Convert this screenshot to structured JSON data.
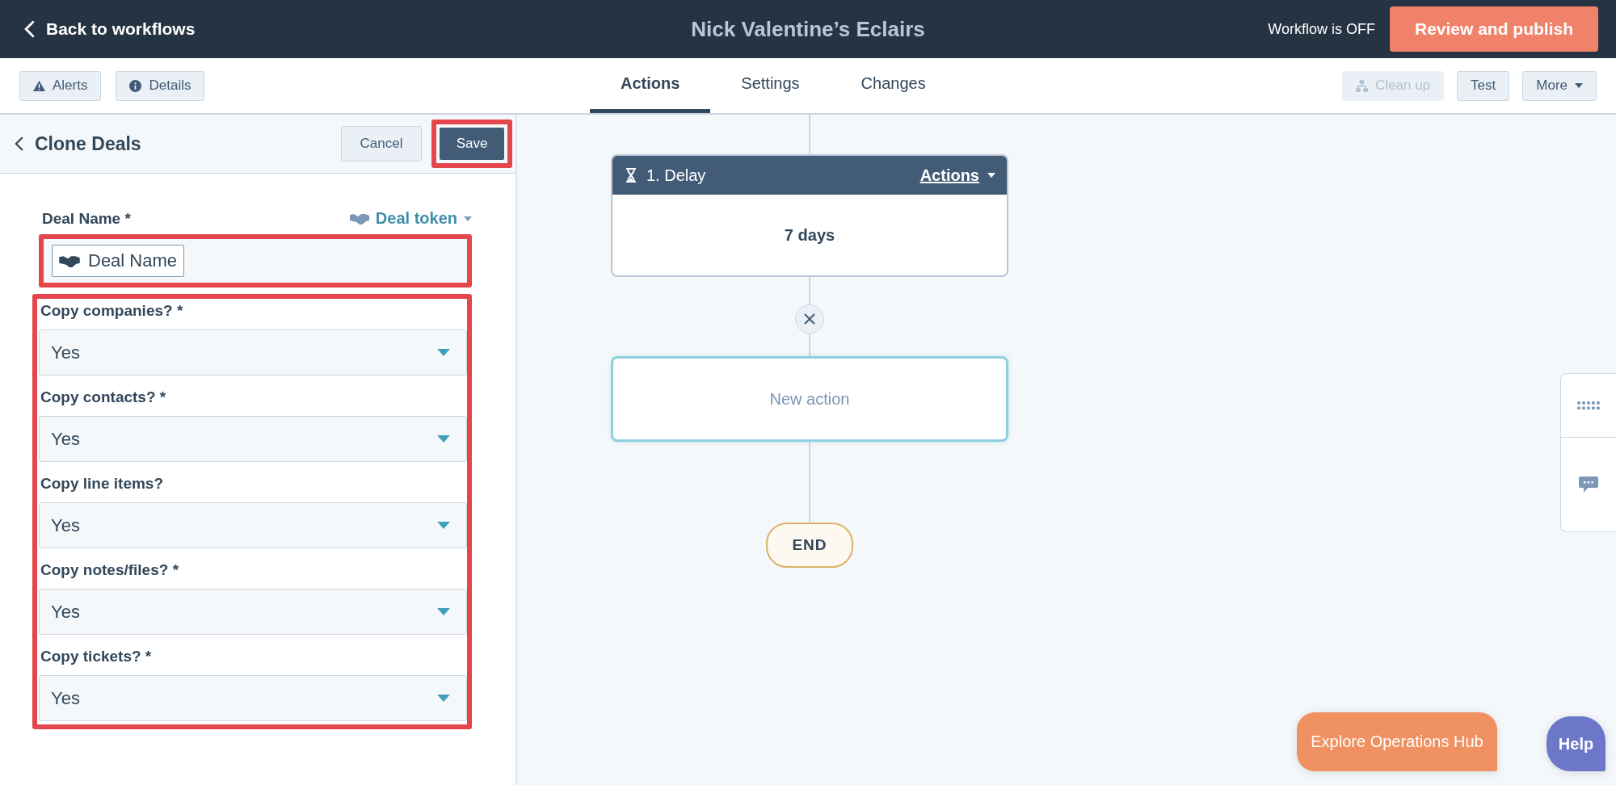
{
  "top_bar": {
    "back_link": "Back to workflows",
    "title": "Nick Valentine’s Eclairs",
    "status": "Workflow is OFF",
    "publish_button": "Review and publish"
  },
  "toolbar": {
    "left_buttons": [
      {
        "label": "Alerts",
        "kind": "alert"
      },
      {
        "label": "Details",
        "kind": "info"
      }
    ],
    "tabs": [
      {
        "label": "Actions",
        "selected": true
      },
      {
        "label": "Settings",
        "selected": false
      },
      {
        "label": "Changes",
        "selected": false
      }
    ],
    "right_buttons": [
      {
        "label": "Clean up",
        "disabled": true,
        "kind": "cleanup"
      },
      {
        "label": "Test",
        "disabled": false,
        "kind": "plain"
      },
      {
        "label": "More",
        "disabled": false,
        "kind": "dropdown"
      }
    ]
  },
  "panel": {
    "title": "Clone Deals",
    "cancel_button": "Cancel",
    "save_button": "Save",
    "deal_name": {
      "label": "Deal Name *",
      "token_link": "Deal token",
      "token_chip": "Deal Name"
    },
    "selects": [
      {
        "label": "Copy companies? *",
        "value": "Yes"
      },
      {
        "label": "Copy contacts? *",
        "value": "Yes"
      },
      {
        "label": "Copy line items?",
        "value": "Yes"
      },
      {
        "label": "Copy notes/files? *",
        "value": "Yes"
      },
      {
        "label": "Copy tickets? *",
        "value": "Yes"
      }
    ]
  },
  "workflow": {
    "delay_step": {
      "title": "1. Delay",
      "actions_menu": "Actions",
      "body": "7 days"
    },
    "new_action": "New action",
    "end": "END"
  },
  "explore_button": "Explore Operations Hub",
  "help_button": "Help"
}
